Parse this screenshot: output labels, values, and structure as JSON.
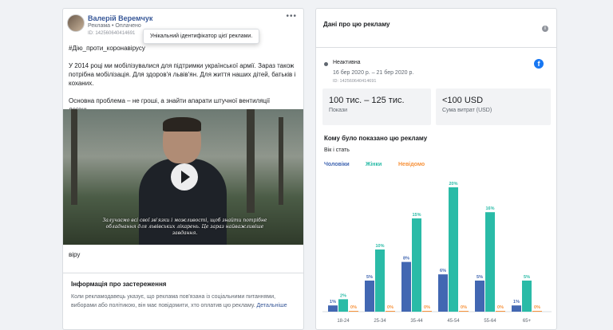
{
  "ad": {
    "author": "Валерій Веремчук",
    "meta": "Реклама • Оплачено",
    "id": "ID: 142560640414691",
    "more": "•••",
    "tooltip": "Унікальний ідентифікатор цієї реклами.",
    "paragraphs": [
      "#Дію_проти_коронавірусу",
      "У 2014 році ми мобілізувалися для підтримки української армії. Зараз також потрібна мобілізація. Для здоров'я львів'ян. Для життя наших дітей, батьків і коханих.",
      "Основна проблема – не гроші, а знайти апарати штучної вентиляції легень,..."
    ],
    "video_subtitle": "Залучаємо всі свої зв'язки і можливості, щоб знайти потрібне обладнання для львівських лікарень. Це зараз найважливіше завдання.",
    "caption": "віру"
  },
  "disclaimer": {
    "title": "Інформація про застереження",
    "text": "Коли рекламодавець указує, що реклама пов'язана із соціальними питаннями, виборами або політикою, він має повідомити, хто оплатив цю рекламу.",
    "link": "Детальніше"
  },
  "details": {
    "title": "Дані про цю рекламу",
    "status": "Неактивна",
    "dates": "16 бер 2020 р. – 21 бер 2020 р.",
    "id": "ID: 142560640414691",
    "impressions_value": "100 тис. – 125 тис.",
    "impressions_label": "Покази",
    "spend_value": "<100 USD",
    "spend_label": "Сума витрат (USD)",
    "audience_title": "Кому було показано цю рекламу",
    "age_gender_title": "Вік і стать"
  },
  "colors": {
    "men": "#4267b2",
    "women": "#2abba7",
    "unknown": "#f7923b",
    "brand": "#1877f2"
  },
  "chart_data": {
    "type": "bar",
    "categories": [
      "18-24",
      "25-34",
      "35-44",
      "45-54",
      "55-64",
      "65+"
    ],
    "series": [
      {
        "name": "Чоловіки",
        "values": [
          1,
          5,
          8,
          6,
          5,
          1
        ],
        "labels": [
          "1%",
          "5%",
          "8%",
          "6%",
          "5%",
          "1%"
        ]
      },
      {
        "name": "Жінки",
        "values": [
          2,
          10,
          15,
          20,
          16,
          5
        ],
        "labels": [
          "2%",
          "10%",
          "15%",
          "20%",
          "16%",
          "5%"
        ]
      },
      {
        "name": "Невідомо",
        "values": [
          0,
          0,
          0,
          0,
          0,
          0
        ],
        "labels": [
          "0%",
          "0%",
          "0%",
          "0%",
          "0%",
          "0%"
        ]
      }
    ],
    "ylim": [
      0,
      20
    ]
  }
}
